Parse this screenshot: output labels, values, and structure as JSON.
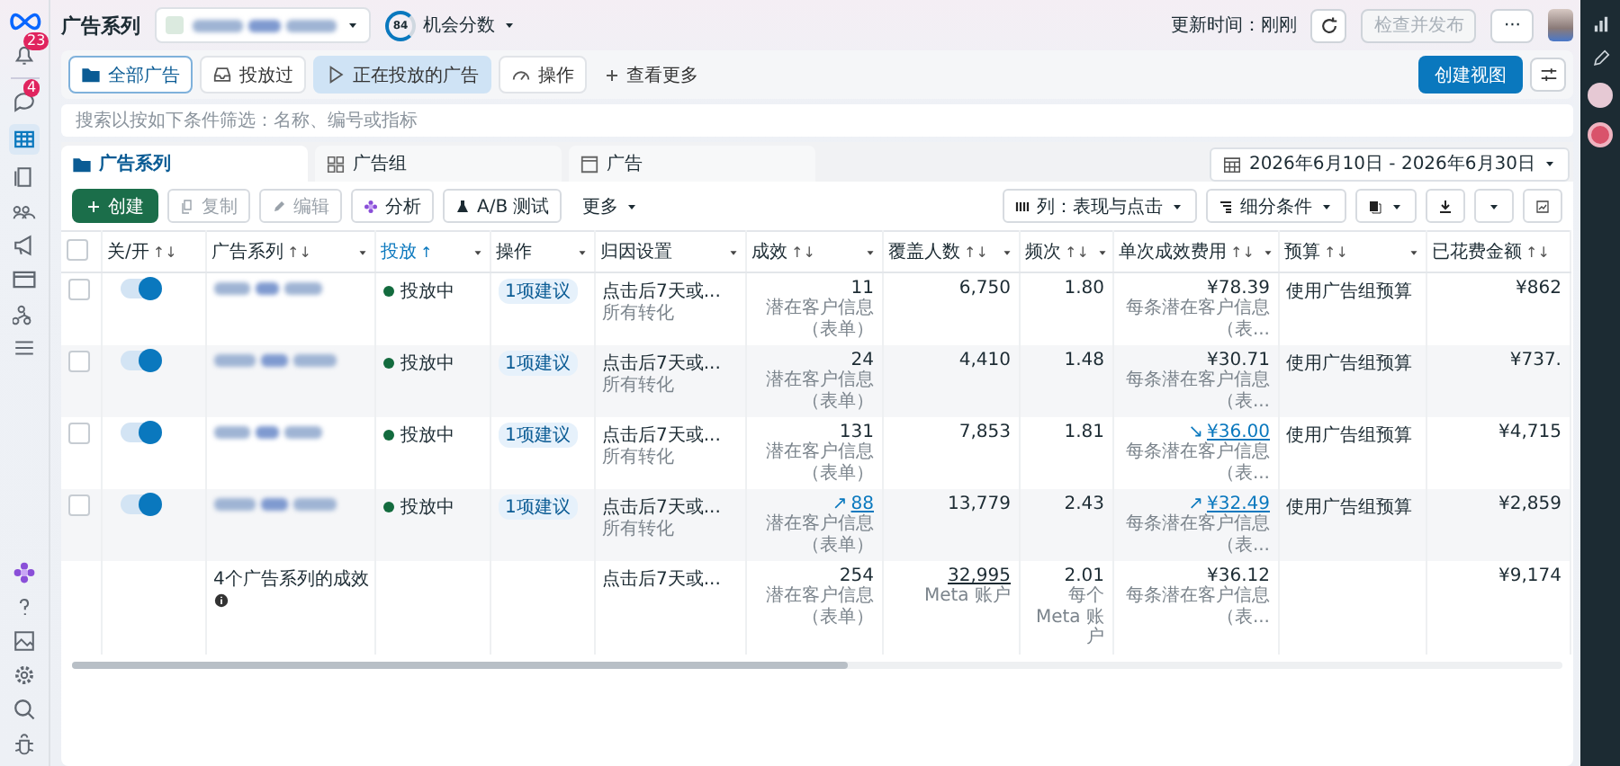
{
  "header": {
    "title": "广告系列",
    "score": "84",
    "score_label": "机会分数",
    "updated": "更新时间：刚刚",
    "publish": "检查并发布",
    "more": "···"
  },
  "sidebar": {
    "notifications_badge": "23",
    "messages_badge": "4"
  },
  "filters": [
    {
      "label": "全部广告",
      "selected": true,
      "active": false
    },
    {
      "label": "投放过",
      "selected": false,
      "active": false
    },
    {
      "label": "正在投放的广告",
      "selected": false,
      "active": true
    },
    {
      "label": "操作",
      "selected": false,
      "active": false
    }
  ],
  "more_filters": "查看更多",
  "create_view": "创建视图",
  "search": {
    "placeholder": "搜索以按如下条件筛选：名称、编号或指标"
  },
  "levels": [
    {
      "label": "广告系列",
      "selected": true
    },
    {
      "label": "广告组",
      "selected": false
    },
    {
      "label": "广告",
      "selected": false
    }
  ],
  "date_range": "2026年6月10日 - 2026年6月30日",
  "actions": [
    {
      "label": "创建",
      "kind": "primary",
      "disabled": false
    },
    {
      "label": "复制",
      "kind": "plain",
      "disabled": true
    },
    {
      "label": "编辑",
      "kind": "plain",
      "disabled": true
    },
    {
      "label": "分析",
      "kind": "plain",
      "disabled": false
    },
    {
      "label": "A/B 测试",
      "kind": "plain",
      "disabled": false
    },
    {
      "label": "更多",
      "kind": "text",
      "disabled": false
    }
  ],
  "view_controls": {
    "columns": "列：表现与点击",
    "breakdown": "细分条件"
  },
  "table": {
    "select_all_checked": false,
    "columns": [
      {
        "label": "关/开",
        "sort": "↑↓",
        "menu": false
      },
      {
        "label": "广告系列",
        "sort": "↑↓",
        "menu": true
      },
      {
        "label": "投放",
        "sort": "↑",
        "menu": true
      },
      {
        "label": "操作",
        "menu": true
      },
      {
        "label": "归因设置",
        "menu": true
      },
      {
        "label": "成效",
        "sort": "↑↓",
        "menu": true
      },
      {
        "label": "覆盖人数",
        "sort": "↑↓",
        "menu": true
      },
      {
        "label": "频次",
        "sort": "↑↓",
        "menu": true
      },
      {
        "label": "单次成效费用",
        "sort": "↑↓",
        "menu": true
      },
      {
        "label": "预算",
        "sort": "↑↓",
        "menu": true
      },
      {
        "label": "已花费金额",
        "sort": "↑↓",
        "menu": false
      }
    ],
    "rows": [
      {
        "checked": false,
        "on": true,
        "status": "投放中",
        "suggestion": "1项建议",
        "attribution": "点击后7天或...",
        "attribution_sub": "所有转化",
        "results": "11",
        "results_sub": "潜在客户信息（表单）",
        "reach": "6,750",
        "frequency": "1.80",
        "cpr": "¥78.39",
        "cpr_sub": "每条潜在客户信息（表...",
        "budget": "使用广告组预算",
        "spent": "¥862"
      },
      {
        "checked": false,
        "on": true,
        "status": "投放中",
        "suggestion": "1项建议",
        "attribution": "点击后7天或...",
        "attribution_sub": "所有转化",
        "results": "24",
        "results_sub": "潜在客户信息（表单）",
        "reach": "4,410",
        "frequency": "1.48",
        "cpr": "¥30.71",
        "cpr_sub": "每条潜在客户信息（表...",
        "budget": "使用广告组预算",
        "spent": "¥737."
      },
      {
        "checked": false,
        "on": true,
        "status": "投放中",
        "suggestion": "1项建议",
        "attribution": "点击后7天或...",
        "attribution_sub": "所有转化",
        "results": "131",
        "results_sub": "潜在客户信息（表单）",
        "reach": "7,853",
        "frequency": "1.81",
        "cpr": "¥36.00",
        "cpr_trend": "↘",
        "cpr_sub": "每条潜在客户信息（表...",
        "budget": "使用广告组预算",
        "spent": "¥4,715"
      },
      {
        "checked": false,
        "on": true,
        "status": "投放中",
        "suggestion": "1项建议",
        "attribution": "点击后7天或...",
        "attribution_sub": "所有转化",
        "results": "88",
        "results_trend": "↗",
        "results_sub": "潜在客户信息（表单）",
        "reach": "13,779",
        "frequency": "2.43",
        "cpr": "¥32.49",
        "cpr_trend": "↗",
        "cpr_sub": "每条潜在客户信息（表...",
        "budget": "使用广告组预算",
        "spent": "¥2,859"
      }
    ],
    "total": {
      "label": "4个广告系列的成效",
      "attribution": "点击后7天或...",
      "results": "254",
      "results_sub": "潜在客户信息（表单）",
      "reach": "32,995",
      "reach_sub": "Meta 账户",
      "frequency": "2.01",
      "frequency_sub": "每个 Meta 账户",
      "cpr": "¥36.12",
      "cpr_sub": "每条潜在客户信息（表...",
      "spent": "¥9,174"
    }
  }
}
